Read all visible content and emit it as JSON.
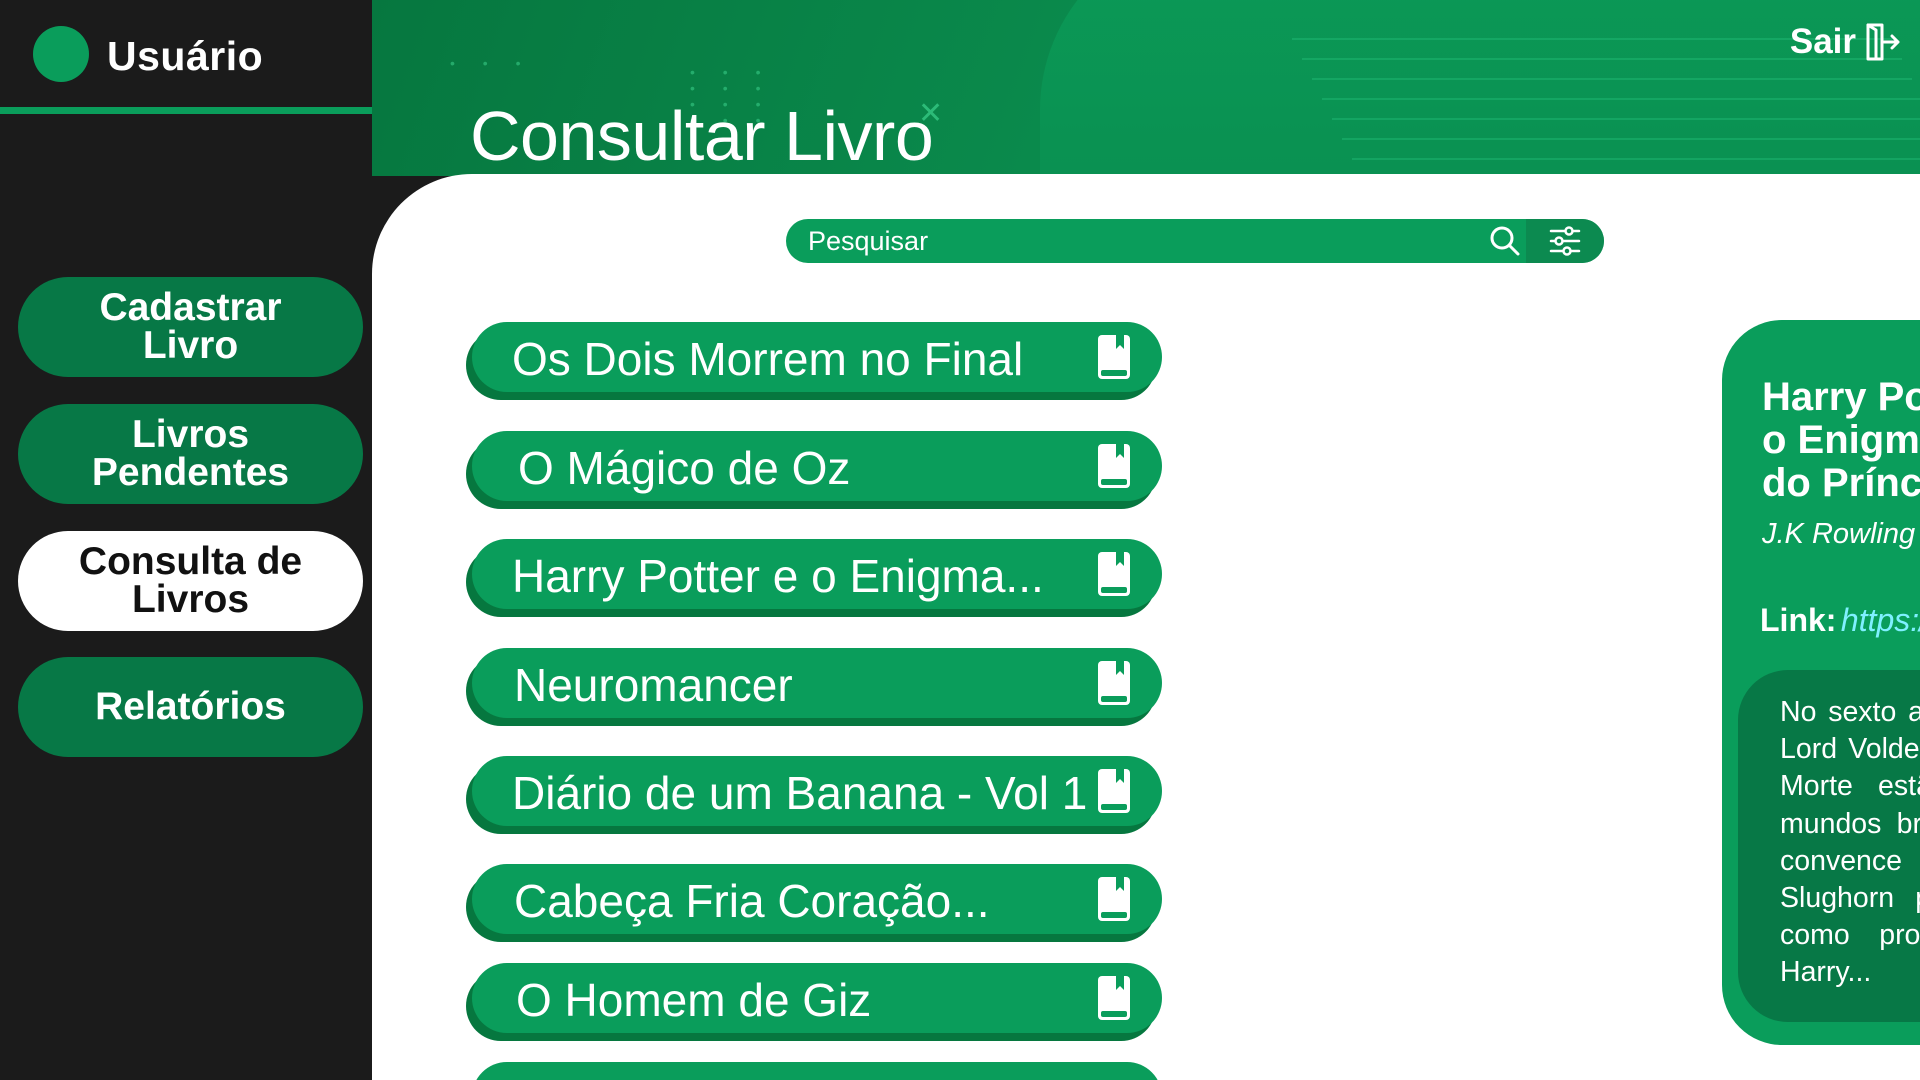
{
  "user": {
    "name": "Usuário"
  },
  "nav": [
    {
      "label": "Cadastrar\nLivro",
      "active": false
    },
    {
      "label": "Livros\nPendentes",
      "active": false
    },
    {
      "label": "Consulta de\nLivros",
      "active": true
    },
    {
      "label": "Relatórios",
      "active": false
    }
  ],
  "header": {
    "title": "Consultar Livro",
    "logout_label": "Sair"
  },
  "search": {
    "placeholder": "Pesquisar",
    "value": ""
  },
  "books": [
    {
      "title": "Os Dois Morrem no Final"
    },
    {
      "title": "O Mágico de Oz"
    },
    {
      "title": "Harry Potter e o Enigma..."
    },
    {
      "title": "Neuromancer"
    },
    {
      "title": "Diário de um Banana - Vol 1"
    },
    {
      "title": "Cabeça Fria Coração..."
    },
    {
      "title": "O Homem de Giz"
    },
    {
      "title": ""
    }
  ],
  "detail": {
    "title_line1": "Harry Potter e",
    "title_line2": "o Enigma",
    "title_line3": "do Príncipe",
    "author": "J.K Rowling",
    "link_label": "Link:",
    "link": "https://www.amazon.com.br/Ha",
    "description": "No sexto ano de Harry em Hogwarts, Lord Voldemort e seus Comensais da Morte estão criando o terror nos mundos bruxo e trouxa. Dumbledore convence seu velho amigo Horácio Slughorn para retornar a Hogwarts como professor de poções após Harry..."
  },
  "colors": {
    "primary": "#0a9d5b",
    "dark_green": "#077846",
    "sidebar_bg": "#1b1b1b",
    "link": "#7ff0ff"
  },
  "icons": {
    "search": "search-icon",
    "filter": "filter-icon",
    "logout": "logout-icon",
    "book": "book-icon"
  }
}
